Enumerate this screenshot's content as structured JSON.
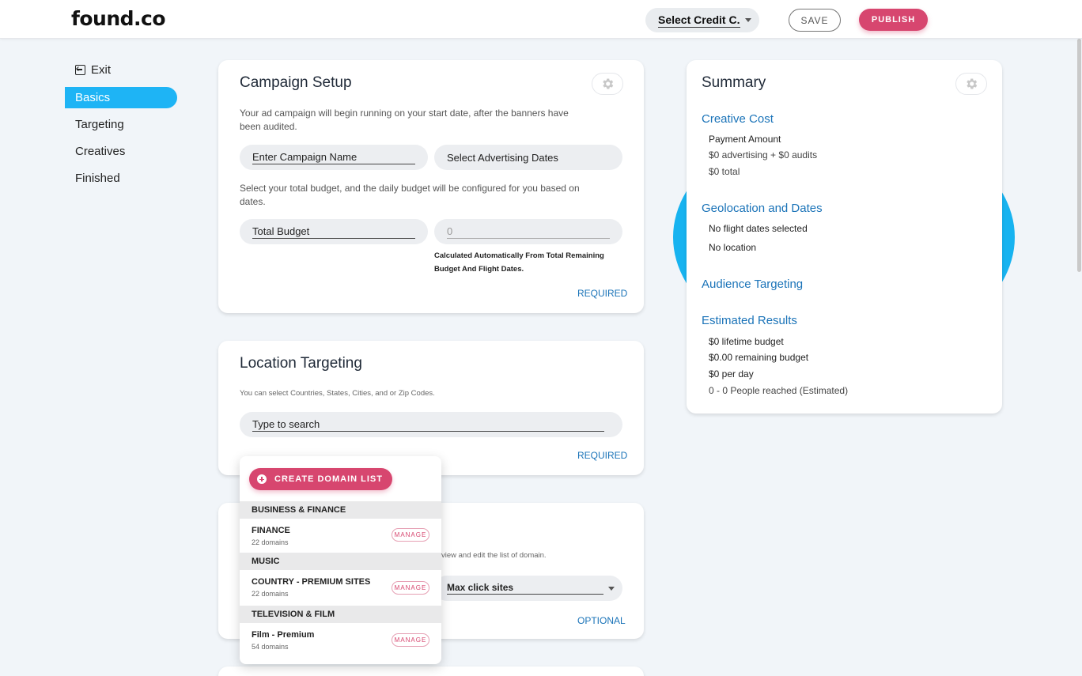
{
  "header": {
    "logo": "found.co",
    "credit_select": "Select Credit C...",
    "save_label": "SAVE",
    "publish_label": "PUBLISH"
  },
  "sidebar": {
    "exit_label": "Exit",
    "items": [
      {
        "label": "Basics",
        "active": true
      },
      {
        "label": "Targeting",
        "active": false
      },
      {
        "label": "Creatives",
        "active": false
      },
      {
        "label": "Finished",
        "active": false
      }
    ]
  },
  "campaign_setup": {
    "title": "Campaign Setup",
    "desc1": "Your ad campaign will begin running on your start date, after the banners have",
    "desc1b": "been audited.",
    "name_placeholder": "Enter Campaign Name",
    "dates_placeholder": "Select Advertising Dates",
    "desc2": "Select your total budget, and the daily budget will be configured for you based on",
    "desc2b": "dates.",
    "budget_placeholder": "Total Budget",
    "daily_value": "0",
    "calc_note1": "Calculated Automatically From Total Remaining",
    "calc_note2": "Budget And Flight Dates.",
    "required": "REQUIRED"
  },
  "location_targeting": {
    "title": "Location Targeting",
    "desc": "You can select Countries, States, Cities, and or Zip Codes.",
    "search_placeholder": "Type to search",
    "required": "REQUIRED"
  },
  "domain_card": {
    "desc_tail": "view and edit the list of domain.",
    "select_value": "Max click sites",
    "optional": "OPTIONAL"
  },
  "domain_dropdown": {
    "create_label": "CREATE DOMAIN LIST",
    "manage_label": "MANAGE",
    "groups": [
      {
        "name": "BUSINESS & FINANCE",
        "item": "FINANCE",
        "count": "22 domains"
      },
      {
        "name": "MUSIC",
        "item": "COUNTRY - PREMIUM SITES",
        "count": "22 domains"
      },
      {
        "name": "TELEVISION & FILM",
        "item": "Film - Premium",
        "count": "54 domains"
      }
    ]
  },
  "summary": {
    "title": "Summary",
    "creative_cost": "Creative Cost",
    "payment_amount": "Payment Amount",
    "payment_detail": "$0 advertising + $0 audits",
    "payment_total": "$0 total",
    "geo_dates": "Geolocation and Dates",
    "no_dates": "No flight dates selected",
    "no_location": "No location",
    "audience": "Audience Targeting",
    "estimated": "Estimated Results",
    "lifetime": "$0 lifetime budget",
    "remaining": "$0.00 remaining budget",
    "per_day": "$0 per day",
    "reached": "0 - 0 People reached (Estimated)"
  },
  "colors": {
    "accent_blue": "#1eb4f5",
    "publish_pink": "#d7466f",
    "link_blue": "#1a73b8"
  },
  "icons": [
    "exit-icon",
    "gear-icon",
    "chevron-down-icon",
    "plus-circle-icon"
  ]
}
